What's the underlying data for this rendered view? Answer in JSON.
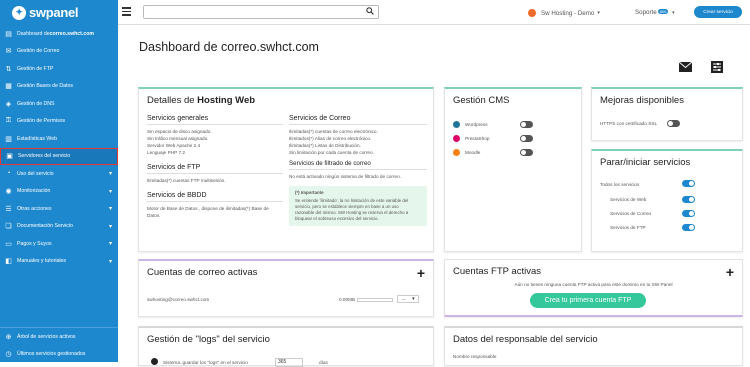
{
  "sidebar": {
    "logo": "swpanel",
    "items": [
      {
        "label_prefix": "Dashboard de ",
        "label_bold": "correo.swhct.com",
        "icon": "dashboard-icon",
        "chev": false
      },
      {
        "label": "Gestión de Correo",
        "icon": "mail-icon",
        "chev": false
      },
      {
        "label": "Gestión de FTP",
        "icon": "ftp-icon",
        "chev": false
      },
      {
        "label": "Gestión Bases de Datos",
        "icon": "database-icon",
        "chev": false
      },
      {
        "label": "Gestión de DNS",
        "icon": "dns-icon",
        "chev": false
      },
      {
        "label": "Gestión de Permisos",
        "icon": "key-icon",
        "chev": false
      },
      {
        "label": "Estadísticas Web",
        "icon": "stats-icon",
        "chev": false
      },
      {
        "label": "Servidores del servicio",
        "icon": "server-icon",
        "chev": false
      },
      {
        "label": "Uso del servicio",
        "icon": "chart-icon",
        "chev": true
      },
      {
        "label": "Monitorización",
        "icon": "monitor-icon",
        "chev": true
      },
      {
        "label": "Otras acciones",
        "icon": "actions-icon",
        "chev": true
      },
      {
        "label": "Documentación Servicio",
        "icon": "doc-icon",
        "chev": true
      },
      {
        "label": "Pagos y Suyos",
        "icon": "payment-icon",
        "chev": true
      },
      {
        "label": "Manuales y tutoriales",
        "icon": "book-icon",
        "chev": true
      }
    ],
    "bottom": [
      {
        "label": "Árbol de servicios activos",
        "icon": "tree-icon"
      },
      {
        "label": "Últimos servicios gestionados",
        "icon": "history-icon"
      }
    ]
  },
  "topbar": {
    "search_placeholder": "",
    "brand": "Sw Hosting - Demo",
    "support": "Soporte",
    "support_badge": "800",
    "new_service": "Crear servicio"
  },
  "page_title": "Dashboard de correo.swhct.com",
  "hosting": {
    "title_prefix": "Detalles de ",
    "title_bold": "Hosting Web",
    "general": {
      "title": "Servicios generales",
      "lines": [
        "Sin espacio de disco asignado.",
        "Sin tráfico mensual asignado.",
        "Servidor Web Apache 2.4",
        "Lenguaje PHP 7.2"
      ]
    },
    "ftp": {
      "title": "Servicios de FTP",
      "lines": [
        "Ilimitadas(*) cuentas FTP multisesión."
      ]
    },
    "bbdd": {
      "title": "Servicios de BBDD",
      "lines": [
        "Motor de Base de Datos , dispone de ilimitadas(*) Base de",
        "Datos."
      ]
    },
    "mail": {
      "title": "Servicios de Correo",
      "lines": [
        "Ilimitadas(*) cuentas de correo electrónico.",
        "Ilimitados(*) Alias de correo electrónico.",
        "Ilimitadas(*) Listas de Distribución.",
        "Sin limitación por cada cuenta de correo."
      ]
    },
    "filter": {
      "title": "Servicios de filtrado de correo",
      "lines": [
        "No está activado ningún sistema de filtrado de correo."
      ]
    },
    "note_title": "(*) Importante",
    "note_lines": [
      "Se entiende 'ilimitado', la no limitación de este variable del",
      "servicio, pero se establece siempre en base a un uso",
      "razonable del mismo. SW Hosting se reserva el derecho a",
      "bloquear el sobreuso excesivo del servicio."
    ]
  },
  "cms": {
    "title": "Gestión CMS",
    "items": [
      {
        "name": "Wordpress",
        "icon": "wordpress-icon",
        "on": false
      },
      {
        "name": "PrestaShop",
        "icon": "prestashop-icon",
        "on": false
      },
      {
        "name": "Moodle",
        "icon": "moodle-icon",
        "on": false
      }
    ]
  },
  "improvements": {
    "title": "Mejoras disponibles",
    "items": [
      {
        "name": "HTTPS con certificado SSL",
        "on": false
      }
    ]
  },
  "services": {
    "title": "Parar/iniciar servicios",
    "all_label": "Todos los servicios",
    "all_on": true,
    "items": [
      {
        "name": "Servicios de Web",
        "on": true
      },
      {
        "name": "Servicios de Correo",
        "on": true
      },
      {
        "name": "Servicios de FTP",
        "on": true
      }
    ]
  },
  "mail_accounts": {
    "title": "Cuentas de correo activas",
    "rows": [
      {
        "email": "swhosting@correo.swhct.com",
        "size": "0.00MB",
        "action": "..."
      }
    ]
  },
  "ftp_accounts": {
    "title": "Cuentas FTP activas",
    "empty": "Aún no tienes ninguna cuenta FTP activa para este dominio en tu SW Panel",
    "button": "Crea tu primera cuenta FTP"
  },
  "logs": {
    "title": "Gestión de \"logs\" del servicio",
    "row_text": "Sistema..guardar los \"logs\" en el servicio",
    "value": "365",
    "unit": "días"
  },
  "owner": {
    "title": "Datos del responsable del servicio",
    "field": "Nombre responsable"
  },
  "colors": {
    "primary": "#1e88cf",
    "green": "#35c89a",
    "accent_green": "#7fd1b5",
    "accent_purple": "#c9b6e4"
  }
}
